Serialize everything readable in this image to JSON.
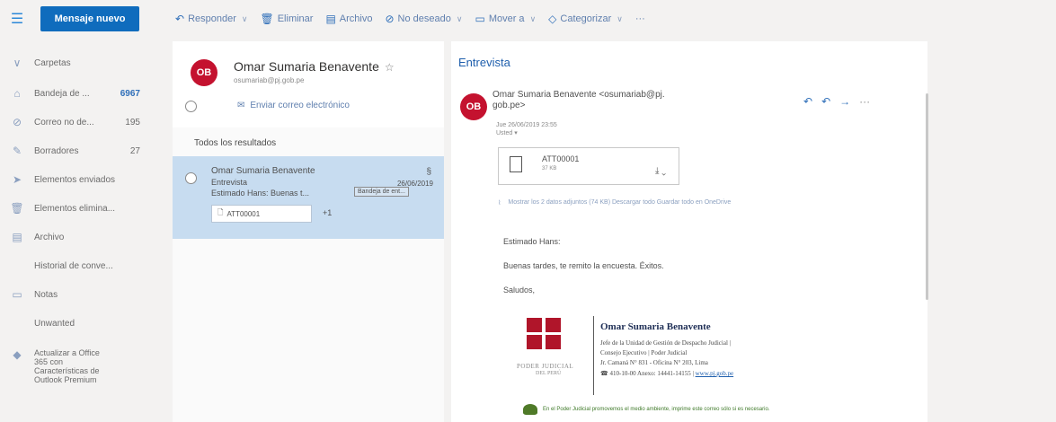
{
  "toolbar": {
    "new_message": "Mensaje nuevo",
    "items": [
      {
        "label": "Responder",
        "icon": "↶",
        "chevron": true
      },
      {
        "label": "Eliminar",
        "icon": "🗑",
        "chevron": false
      },
      {
        "label": "Archivo",
        "icon": "▤",
        "chevron": false
      },
      {
        "label": "No deseado",
        "icon": "⊘",
        "chevron": true
      },
      {
        "label": "Mover a",
        "icon": "▭",
        "chevron": true
      },
      {
        "label": "Categorizar",
        "icon": "◇",
        "chevron": true
      },
      {
        "label": "···",
        "icon": "",
        "chevron": false
      }
    ]
  },
  "sidebar": {
    "items": [
      {
        "label": "Carpetas",
        "count": "",
        "icon": "chevron"
      },
      {
        "label": "Bandeja de ...",
        "count": "6967",
        "icon": "inbox"
      },
      {
        "label": "Correo no de...",
        "count": "195",
        "icon": "junk"
      },
      {
        "label": "Borradores",
        "count": "27",
        "icon": "pencil"
      },
      {
        "label": "Elementos enviados",
        "count": "",
        "icon": "send"
      },
      {
        "label": "Elementos elimina...",
        "count": "",
        "icon": "trash"
      },
      {
        "label": "Archivo",
        "count": "",
        "icon": "archive"
      },
      {
        "label": "Historial de conve...",
        "count": "",
        "icon": ""
      },
      {
        "label": "Notas",
        "count": "",
        "icon": "note"
      },
      {
        "label": "Unwanted",
        "count": "",
        "icon": ""
      },
      {
        "label": "Actualizar a Office 365 con Características de Outlook Premium",
        "count": "",
        "icon": "diamond"
      }
    ]
  },
  "contact_card": {
    "initials": "OB",
    "name": "Omar Sumaria Benavente",
    "star": "☆",
    "email": "osumariab@pj.gob.pe",
    "send_email": "Enviar correo electrónico"
  },
  "results_header": "Todos los resultados",
  "message": {
    "from": "Omar Sumaria Benavente",
    "subject": "Entrevista",
    "date": "26/06/2019",
    "preview": "Estimado Hans: Buenas t...",
    "tag": "Bandeja de ent...",
    "attachment": "ATT00001",
    "more": "+1"
  },
  "reading": {
    "subject": "Entrevista",
    "avatar": "OB",
    "from_line1": "Omar Sumaria Benavente <osumariab@pj.",
    "from_line2": "gob.pe>",
    "date": "Jue 26/06/2019 23:55",
    "to": "Usted ▾",
    "attachment_name": "ATT00001",
    "attachment_size": "37 KB",
    "attachment_links": "Mostrar los 2 datos adjuntos (74 KB)   Descargar todo   Guardar todo en OneDrive",
    "body": [
      "Estimado Hans:",
      "Buenas tardes, te remito la encuesta. Éxitos.",
      "Saludos,"
    ],
    "signature": {
      "org1": "PODER JUDICIAL",
      "org2": "DEL PERÚ",
      "name": "Omar Sumaria Benavente",
      "lines": [
        "Jefe de la Unidad de Gestión de Despacho Judicial |",
        "Consejo Ejecutivo | Poder Judicial",
        "Jr. Camaná N° 831 - Oficina N° 203, Lima"
      ],
      "phone": "410-10-00 Anexo: 14441-14155 |",
      "link": "www.pj.gob.pe",
      "footer": "En el Poder Judicial promovemos el medio ambiente, imprime este correo sólo si es necesario."
    }
  },
  "colors": {
    "accent": "#0f6cbd",
    "avatar": "#c4122f",
    "selected": "#c7dcf0"
  }
}
